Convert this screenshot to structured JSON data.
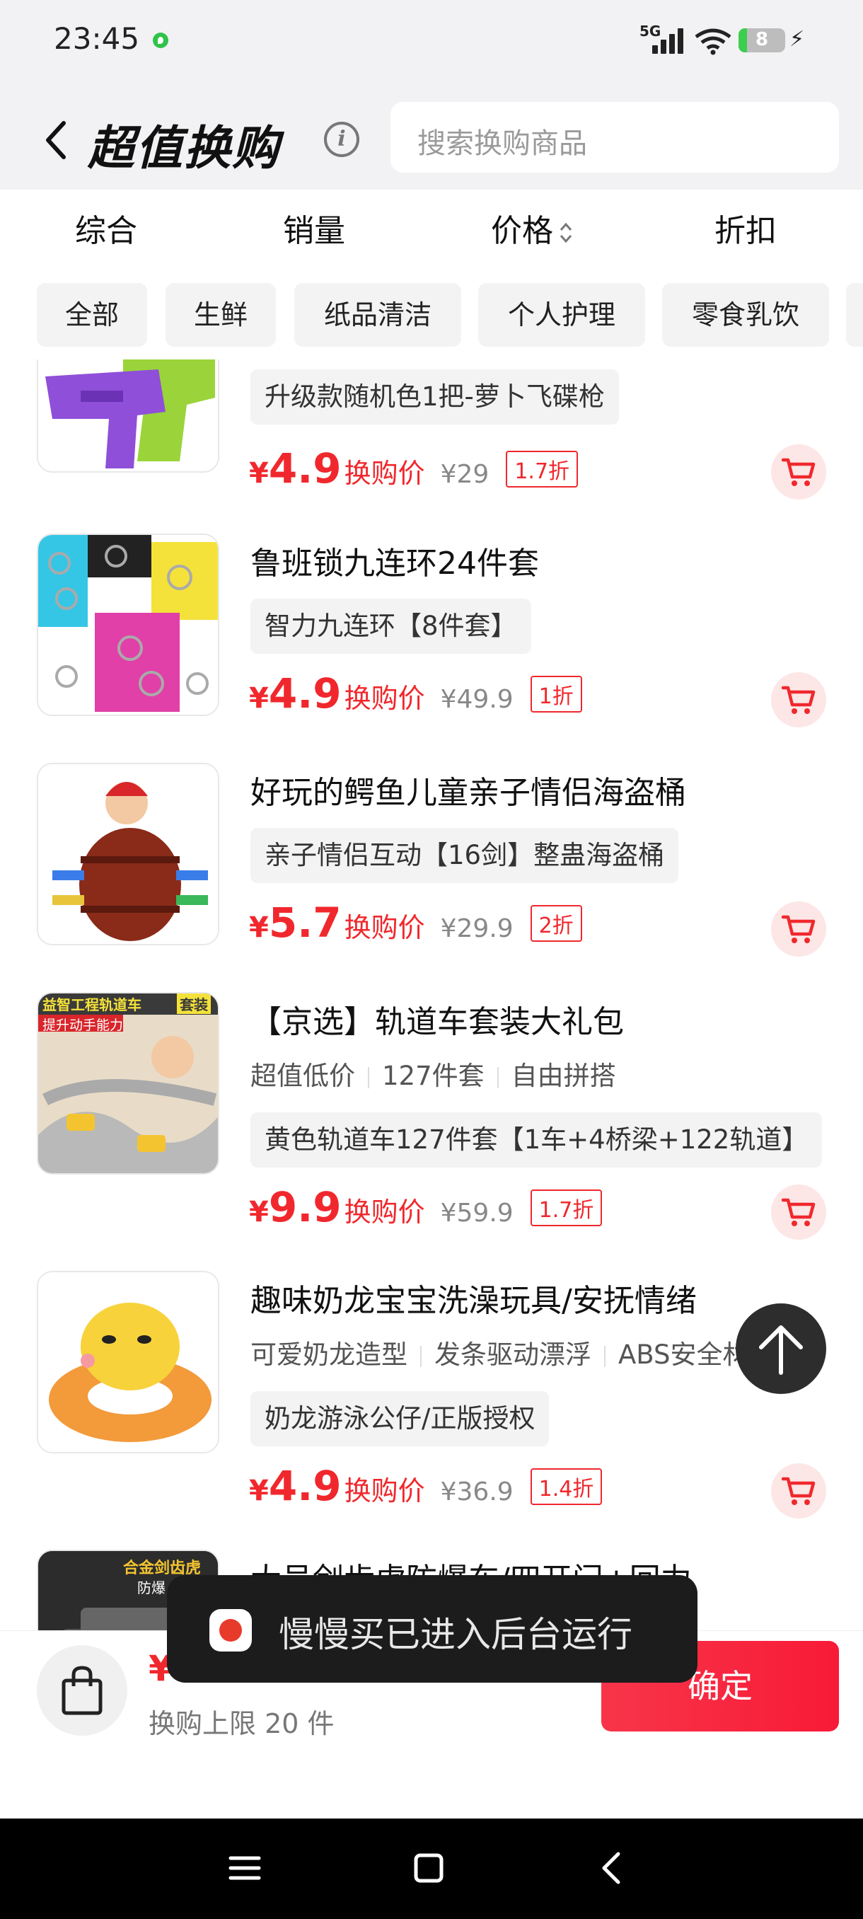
{
  "status_bar": {
    "time": "23:45",
    "network": "5G",
    "battery": "8"
  },
  "header": {
    "title": "超值换购",
    "search_placeholder": "搜索换购商品"
  },
  "sort_tabs": [
    "综合",
    "销量",
    "价格",
    "折扣"
  ],
  "categories": [
    "全部",
    "生鲜",
    "纸品清洁",
    "个人护理",
    "零食乳饮"
  ],
  "products": [
    {
      "title": "",
      "tags": [],
      "variant": "升级款随机色1把-萝卜飞碟枪",
      "price": "4.9",
      "price_label": "换购价",
      "original": "¥29",
      "discount": "1.7折",
      "thumb": "toy-gun"
    },
    {
      "title": "鲁班锁九连环24件套",
      "tags": [],
      "variant": "智力九连环【8件套】",
      "price": "4.9",
      "price_label": "换购价",
      "original": "¥49.9",
      "discount": "1折",
      "thumb": "puzzle-rings"
    },
    {
      "title": "好玩的鳄鱼儿童亲子情侣海盗桶",
      "tags": [],
      "variant": "亲子情侣互动【16剑】整蛊海盗桶",
      "price": "5.7",
      "price_label": "换购价",
      "original": "¥29.9",
      "discount": "2折",
      "thumb": "pirate-barrel"
    },
    {
      "title": "【京选】轨道车套装大礼包",
      "tags": [
        "超值低价",
        "127件套",
        "自由拼搭"
      ],
      "variant": "黄色轨道车127件套【1车+4桥梁+122轨道】",
      "price": "9.9",
      "price_label": "换购价",
      "original": "¥59.9",
      "discount": "1.7折",
      "thumb": "track-car",
      "thumb_text": [
        "益智工程轨道车",
        "套装",
        "提升动手能力"
      ]
    },
    {
      "title": "趣味奶龙宝宝洗澡玩具/安抚情绪",
      "tags": [
        "可爱奶龙造型",
        "发条驱动漂浮",
        "ABS安全材质"
      ],
      "variant": "奶龙游泳公仔/正版授权",
      "price": "4.9",
      "price_label": "换购价",
      "original": "¥36.9",
      "discount": "1.4折",
      "thumb": "duck-toy"
    },
    {
      "title": "大号剑齿虎防爆车/四开门+回力",
      "tags": [],
      "variant": "",
      "price": "",
      "price_label": "",
      "original": "",
      "discount": "",
      "thumb": "police-car",
      "thumb_text": [
        "合金剑齿虎",
        "防爆"
      ]
    }
  ],
  "toast": {
    "text": "慢慢买已进入后台运行"
  },
  "bottom_bar": {
    "total": "¥0.00",
    "limit": "换购上限 20 件",
    "confirm": "确定"
  },
  "yen": "¥"
}
